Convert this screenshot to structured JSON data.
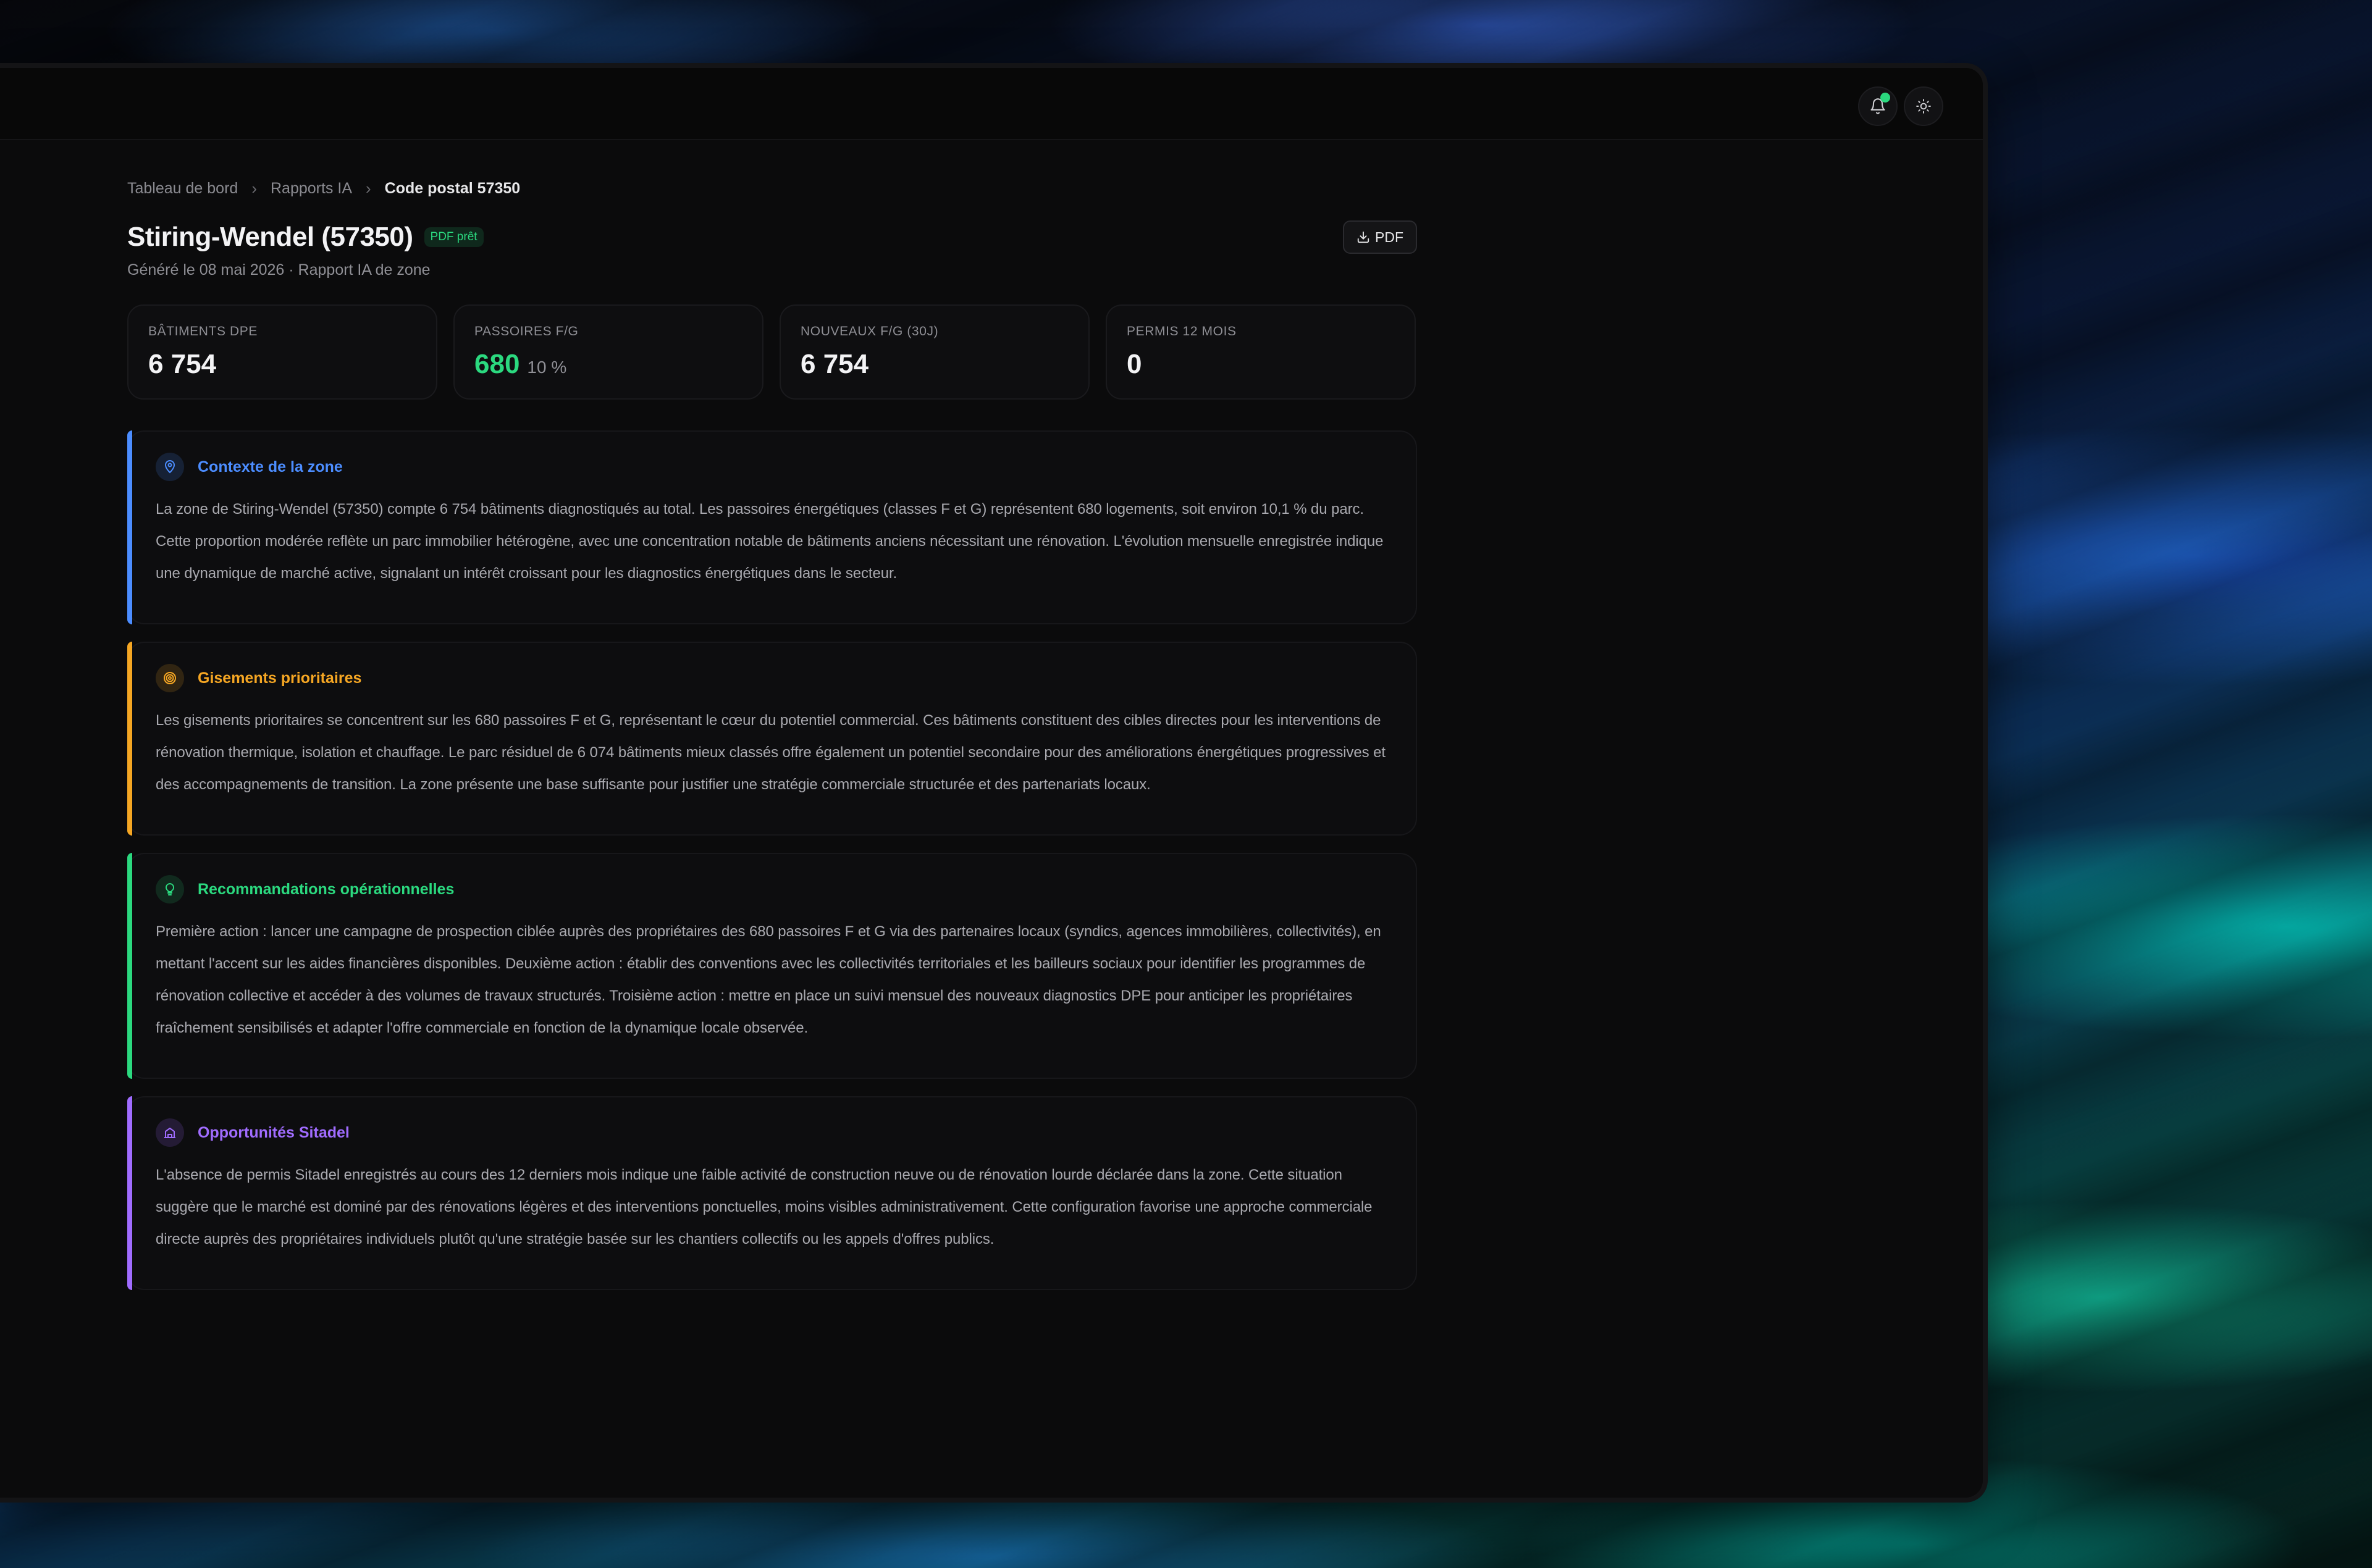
{
  "breadcrumb": {
    "items": [
      "Tableau de bord",
      "Rapports IA"
    ],
    "current": "Code postal 57350"
  },
  "header": {
    "title": "Stiring-Wendel (57350)",
    "badge": "PDF prêt",
    "subtitle": "Généré le 08 mai 2026 · Rapport IA de zone",
    "pdf_button": "PDF"
  },
  "stats": [
    {
      "label": "BÂTIMENTS DPE",
      "value": "6 754",
      "sub": ""
    },
    {
      "label": "PASSOIRES F/G",
      "value": "680",
      "sub": "10 %"
    },
    {
      "label": "NOUVEAUX F/G (30J)",
      "value": "6 754",
      "sub": ""
    },
    {
      "label": "PERMIS 12 MOIS",
      "value": "0",
      "sub": ""
    }
  ],
  "sections": {
    "context": {
      "title": "Contexte de la zone",
      "icon": "map-pin-icon",
      "text": "La zone de Stiring-Wendel (57350) compte 6 754 bâtiments diagnostiqués au total. Les passoires énergétiques (classes F et G) représentent 680 logements, soit environ 10,1 % du parc. Cette proportion modérée reflète un parc immobilier hétérogène, avec une concentration notable de bâtiments anciens nécessitant une rénovation. L'évolution mensuelle enregistrée indique une dynamique de marché active, signalant un intérêt croissant pour les diagnostics énergétiques dans le secteur."
    },
    "gisements": {
      "title": "Gisements prioritaires",
      "icon": "target-icon",
      "text": "Les gisements prioritaires se concentrent sur les 680 passoires F et G, représentant le cœur du potentiel commercial. Ces bâtiments constituent des cibles directes pour les interventions de rénovation thermique, isolation et chauffage. Le parc résiduel de 6 074 bâtiments mieux classés offre également un potentiel secondaire pour des améliorations énergétiques progressives et des accompagnements de transition. La zone présente une base suffisante pour justifier une stratégie commerciale structurée et des partenariats locaux."
    },
    "recommandations": {
      "title": "Recommandations opérationnelles",
      "icon": "lightbulb-icon",
      "text": "Première action : lancer une campagne de prospection ciblée auprès des propriétaires des 680 passoires F et G via des partenaires locaux (syndics, agences immobilières, collectivités), en mettant l'accent sur les aides financières disponibles. Deuxième action : établir des conventions avec les collectivités territoriales et les bailleurs sociaux pour identifier les programmes de rénovation collective et accéder à des volumes de travaux structurés. Troisième action : mettre en place un suivi mensuel des nouveaux diagnostics DPE pour anticiper les propriétaires fraîchement sensibilisés et adapter l'offre commerciale en fonction de la dynamique locale observée."
    },
    "sitadel": {
      "title": "Opportunités Sitadel",
      "icon": "building-icon",
      "text": "L'absence de permis Sitadel enregistrés au cours des 12 derniers mois indique une faible activité de construction neuve ou de rénovation lourde déclarée dans la zone. Cette situation suggère que le marché est dominé par des rénovations légères et des interventions ponctuelles, moins visibles administrativement. Cette configuration favorise une approche commerciale directe auprès des propriétaires individuels plutôt qu'une stratégie basée sur les chantiers collectifs ou les appels d'offres publics."
    }
  },
  "colors": {
    "accent_blue": "#4c8dff",
    "accent_orange": "#f5a623",
    "accent_green": "#2bd97f",
    "accent_purple": "#a06cff",
    "background": "#0b0b0c"
  }
}
